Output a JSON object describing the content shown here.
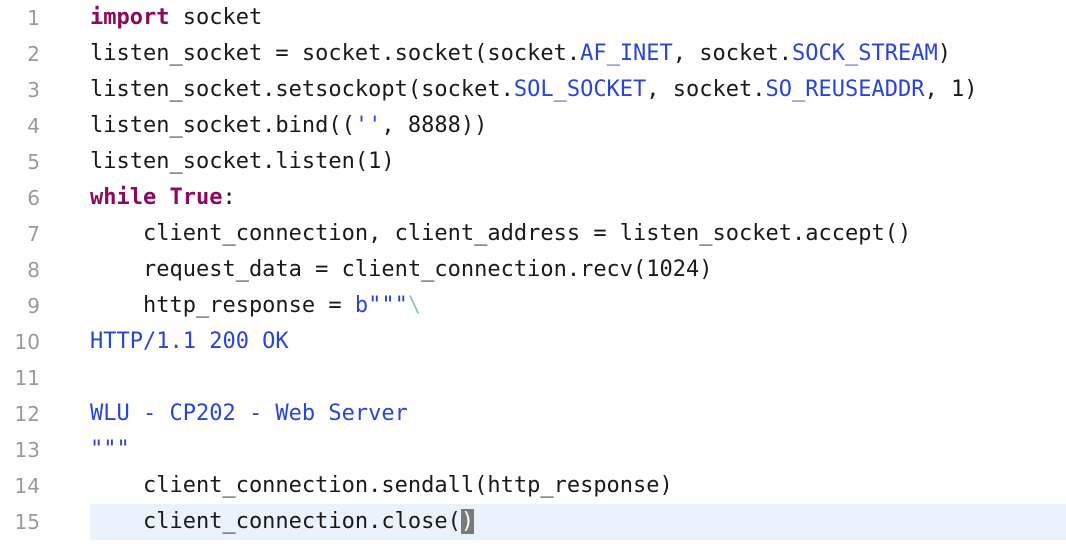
{
  "editor": {
    "lines": [
      {
        "num": "1",
        "segments": [
          {
            "t": "import",
            "c": "kw"
          },
          {
            "t": " socket",
            "c": ""
          }
        ]
      },
      {
        "num": "2",
        "segments": [
          {
            "t": "listen_socket = socket.socket(socket.",
            "c": ""
          },
          {
            "t": "AF_INET",
            "c": "attr"
          },
          {
            "t": ", socket.",
            "c": ""
          },
          {
            "t": "SOCK_STREAM",
            "c": "attr"
          },
          {
            "t": ")",
            "c": ""
          }
        ]
      },
      {
        "num": "3",
        "segments": [
          {
            "t": "listen_socket.setsockopt(socket.",
            "c": ""
          },
          {
            "t": "SOL_SOCKET",
            "c": "attr"
          },
          {
            "t": ", socket.",
            "c": ""
          },
          {
            "t": "SO_REUSEADDR",
            "c": "attr"
          },
          {
            "t": ", 1)",
            "c": ""
          }
        ]
      },
      {
        "num": "4",
        "segments": [
          {
            "t": "listen_socket.bind((",
            "c": ""
          },
          {
            "t": "''",
            "c": "str"
          },
          {
            "t": ", 8888))",
            "c": ""
          }
        ]
      },
      {
        "num": "5",
        "segments": [
          {
            "t": "listen_socket.listen(1)",
            "c": ""
          }
        ]
      },
      {
        "num": "6",
        "segments": [
          {
            "t": "while",
            "c": "kw"
          },
          {
            "t": " ",
            "c": ""
          },
          {
            "t": "True",
            "c": "kw"
          },
          {
            "t": ":",
            "c": ""
          }
        ]
      },
      {
        "num": "7",
        "segments": [
          {
            "t": "    client_connection, client_address = listen_socket.accept()",
            "c": ""
          }
        ]
      },
      {
        "num": "8",
        "segments": [
          {
            "t": "    request_data = client_connection.recv(1024)",
            "c": ""
          }
        ]
      },
      {
        "num": "9",
        "segments": [
          {
            "t": "    http_response = ",
            "c": ""
          },
          {
            "t": "b\"\"\"",
            "c": "str"
          },
          {
            "t": "\\",
            "c": "esc"
          }
        ]
      },
      {
        "num": "10",
        "segments": [
          {
            "t": "HTTP/1.1 200 OK",
            "c": "str"
          }
        ]
      },
      {
        "num": "11",
        "segments": []
      },
      {
        "num": "12",
        "segments": [
          {
            "t": "WLU - CP202 - Web Server",
            "c": "str"
          }
        ]
      },
      {
        "num": "13",
        "segments": [
          {
            "t": "\"\"\"",
            "c": "str"
          }
        ]
      },
      {
        "num": "14",
        "segments": [
          {
            "t": "    client_connection.sendall(http_response)",
            "c": ""
          }
        ]
      },
      {
        "num": "15",
        "segments": [
          {
            "t": "    client_connection.close(",
            "c": ""
          },
          {
            "t": ")",
            "c": "caret-paren"
          }
        ],
        "current": true
      }
    ]
  }
}
